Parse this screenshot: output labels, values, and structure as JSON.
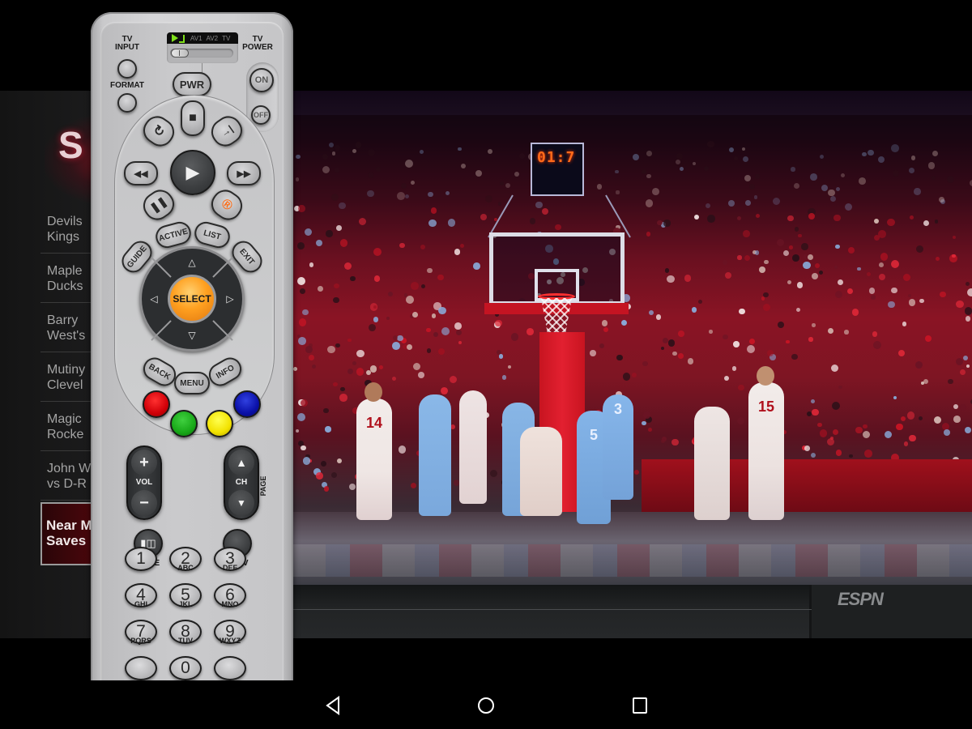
{
  "background_app": {
    "logo_text": "S",
    "list_items": [
      {
        "line1": "Devils",
        "line2": "Kings"
      },
      {
        "line1": "Maple",
        "line2": "Ducks"
      },
      {
        "line1": "Barry",
        "line2": "West's"
      },
      {
        "line1": "Mutiny",
        "line2": "Clevel"
      },
      {
        "line1": "Magic",
        "line2": "Rocke"
      },
      {
        "line1": "John W",
        "line2": "vs D-R"
      }
    ],
    "selected_item": {
      "line1": "Near M",
      "line2": "Saves"
    },
    "video": {
      "shot_clock": "01:7",
      "network_logo": "ESPN",
      "jersey_numbers": [
        "14",
        "5",
        "3",
        "15"
      ]
    }
  },
  "remote": {
    "mode_switch": {
      "options": [
        "AV1",
        "AV2",
        "TV"
      ],
      "selected": "AV1"
    },
    "tv_input_label": "TV INPUT",
    "format_label": "FORMAT",
    "tv_power_label": "TV POWER",
    "pwr_label": "PWR",
    "on_label": "ON",
    "off_label": "OFF",
    "transport": {
      "stop": "■",
      "replay": "↻",
      "advance": "→|",
      "rewind": "◀◀",
      "play": "▶",
      "fast_forward": "▶▶",
      "pause": "❚❚",
      "record": "®"
    },
    "active_label": "ACTIVE",
    "list_label": "LIST",
    "guide_label": "GUIDE",
    "exit_label": "EXIT",
    "select_label": "SELECT",
    "arrows": {
      "up": "△",
      "down": "▽",
      "left": "◁",
      "right": "▷"
    },
    "back_label": "BACK",
    "menu_label": "MENU",
    "info_label": "INFO",
    "color_buttons": {
      "red": "#d00008",
      "green": "#18a818",
      "yellow": "#f2e200",
      "blue": "#0a10a8"
    },
    "vol": {
      "label": "VOL",
      "plus": "+",
      "minus": "−"
    },
    "ch": {
      "label": "CH",
      "up": "▲",
      "down": "▼",
      "page_label": "PAGE"
    },
    "mute_label": "MUTE",
    "prev_label": "PREV",
    "keypad": [
      {
        "digit": "1",
        "sub": ""
      },
      {
        "digit": "2",
        "sub": "ABC"
      },
      {
        "digit": "3",
        "sub": "DEF"
      },
      {
        "digit": "4",
        "sub": "GHI"
      },
      {
        "digit": "5",
        "sub": "JKL"
      },
      {
        "digit": "6",
        "sub": "MNO"
      },
      {
        "digit": "7",
        "sub": "PQRS"
      },
      {
        "digit": "8",
        "sub": "TUV"
      },
      {
        "digit": "9",
        "sub": "WXYZ"
      },
      {
        "digit": "",
        "sub": ""
      },
      {
        "digit": "0",
        "sub": ""
      },
      {
        "digit": "",
        "sub": ""
      }
    ]
  },
  "navbar": {
    "back": "back-icon",
    "home": "home-icon",
    "recents": "recents-icon"
  }
}
